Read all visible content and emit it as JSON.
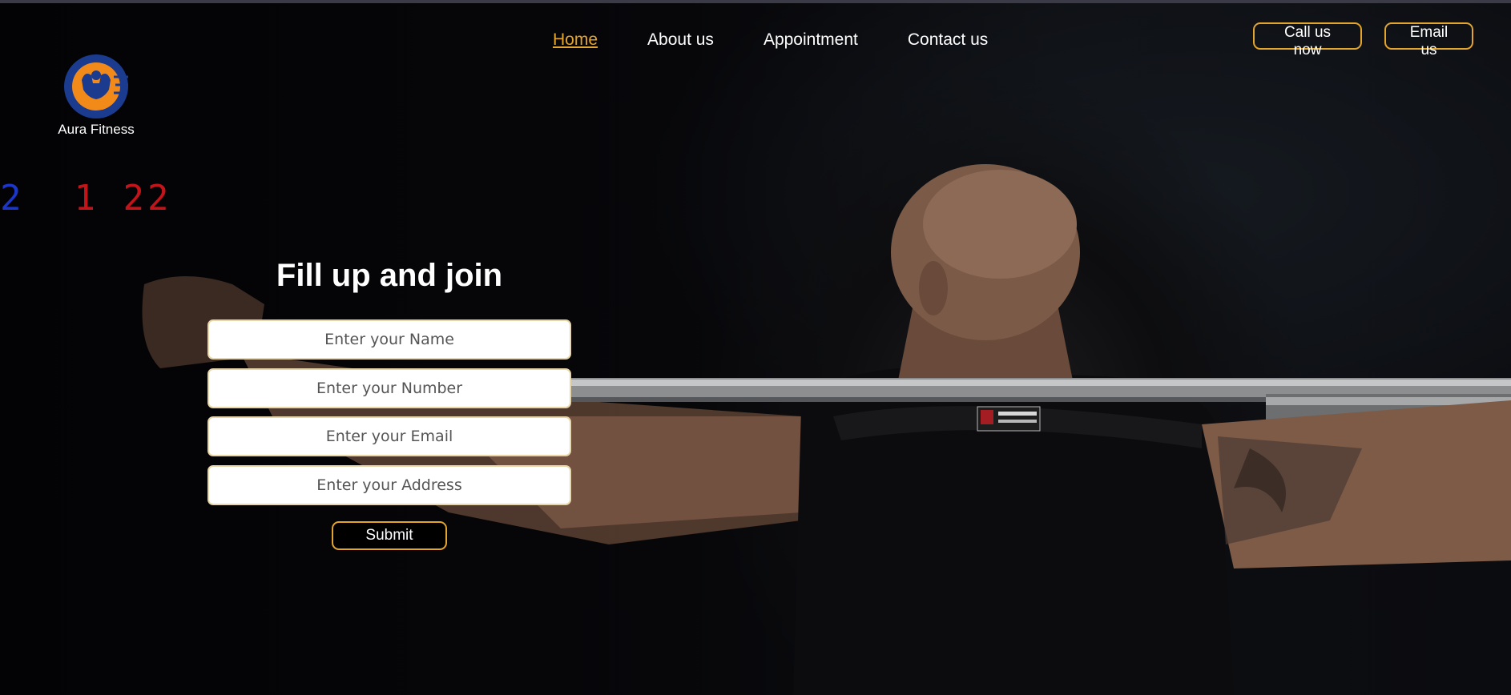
{
  "brand": {
    "name": "Aura Fitness",
    "logo_icon": "bodybuilder-icon"
  },
  "nav": {
    "items": [
      "Home",
      "About us",
      "Appointment",
      "Contact us"
    ],
    "active": "Home"
  },
  "cta": {
    "call_label": "Call us now",
    "email_label": "Email us"
  },
  "background": {
    "clock_left": "2",
    "clock_right": "1 22"
  },
  "form": {
    "title": "Fill up and join",
    "name_placeholder": "Enter your Name",
    "number_placeholder": "Enter your Number",
    "email_placeholder": "Enter your Email",
    "address_placeholder": "Enter your Address",
    "submit_label": "Submit"
  },
  "colors": {
    "accent": "#e4a52c",
    "logo_blue": "#1a3b8e",
    "logo_orange": "#f28a1a",
    "background": "#050608"
  }
}
